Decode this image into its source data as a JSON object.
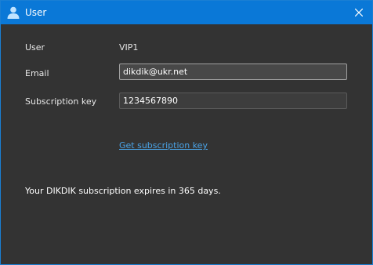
{
  "window": {
    "title": "User",
    "title_icon": "user-icon",
    "close_icon": "close-icon",
    "accent_color": "#0a78d7"
  },
  "form": {
    "user_label": "User",
    "user_value": "VIP1",
    "email_label": "Email",
    "email_value": "dikdik@ukr.net",
    "subscription_label": "Subscription key",
    "subscription_value": "1234567890"
  },
  "link": {
    "text": "Get subscription key"
  },
  "status": {
    "message": "Your DIKDIK subscription expires in 365 days."
  }
}
